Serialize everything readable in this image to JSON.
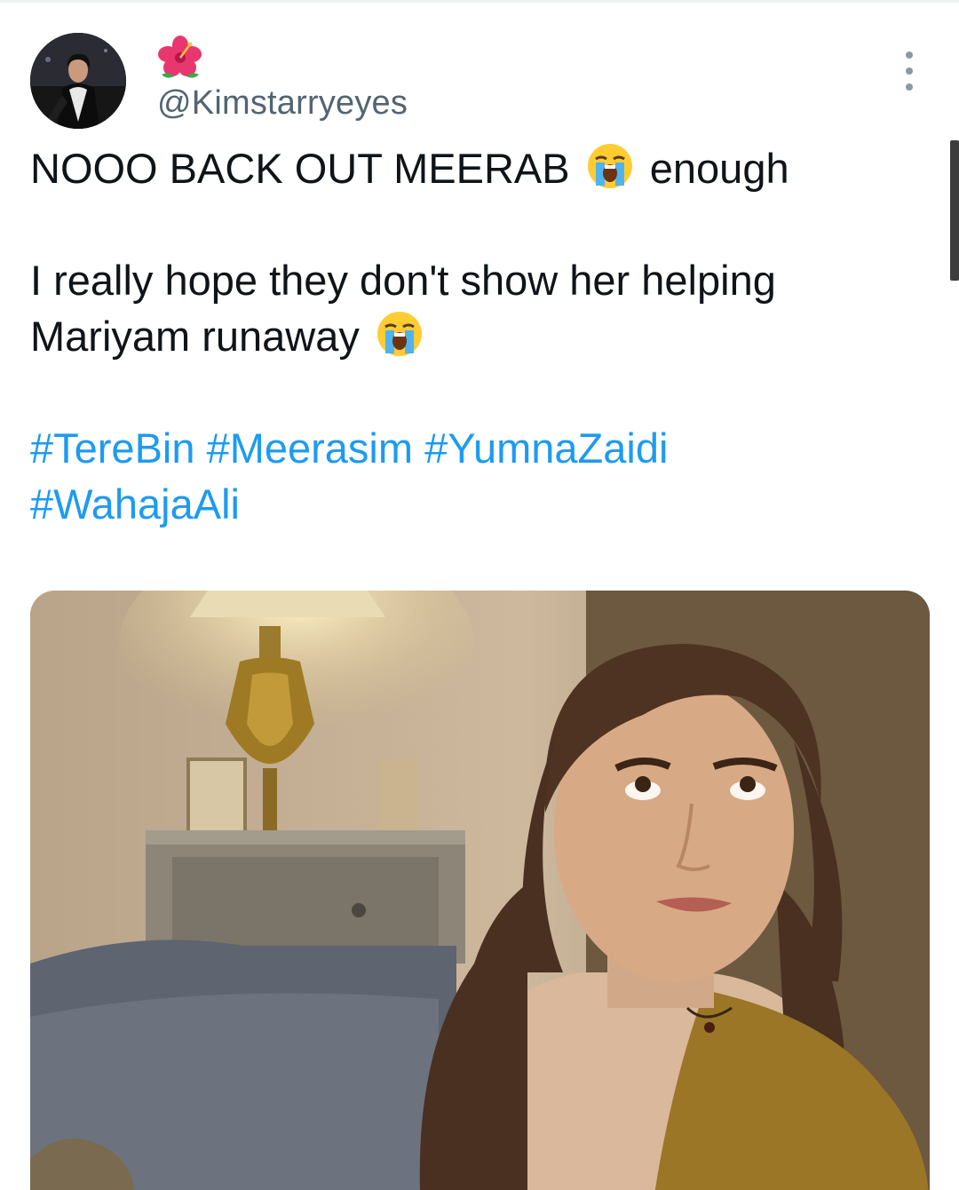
{
  "tweet": {
    "display_name_emoji": "🌺",
    "handle": "@Kimstarryeyes",
    "line1_before": "NOOO BACK OUT MEERAB",
    "line1_after": "enough",
    "line2_before": "I really hope they don't show her helping Mariyam runaway",
    "hashtags": [
      "#TereBin",
      "#Meerasim",
      "#YumnaZaidi",
      "#WahajaAli"
    ]
  },
  "icons": {
    "avatar": "profile-photo",
    "display_name": "hibiscus-emoji",
    "crying_emoji": "loudly-crying-face-emoji",
    "more": "vertical-ellipsis-icon"
  },
  "colors": {
    "text": "#0f1419",
    "handle": "#536471",
    "hashtag": "#1d9bf0",
    "background": "#ffffff"
  }
}
